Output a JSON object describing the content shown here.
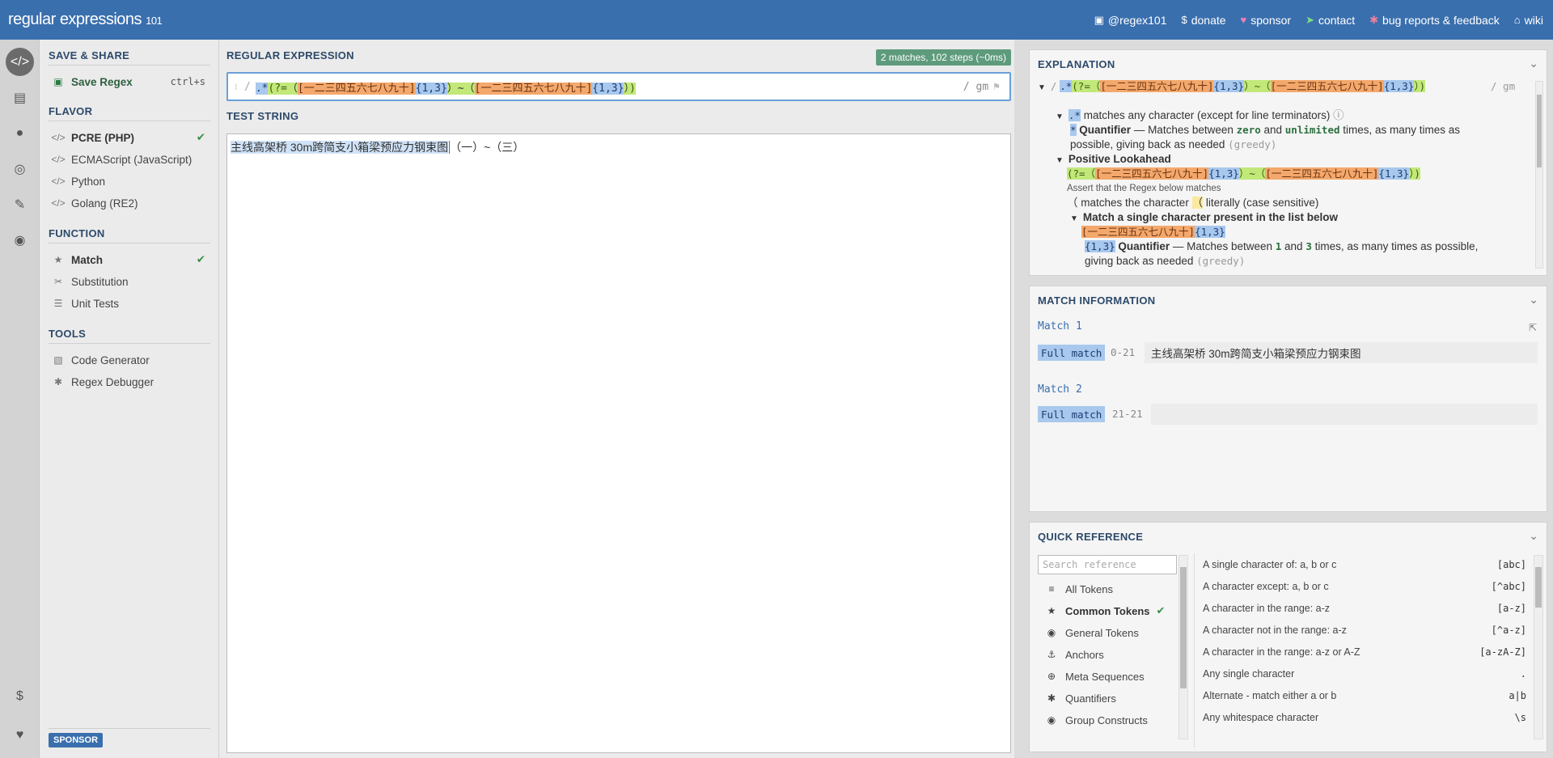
{
  "header": {
    "logo_main": "regular expressions",
    "logo_sup": "101",
    "nav": [
      {
        "icon": "twitter-icon",
        "label": "@regex101"
      },
      {
        "icon": "dollar-icon",
        "label": "donate"
      },
      {
        "icon": "heart-icon",
        "label": "sponsor"
      },
      {
        "icon": "paper-plane-icon",
        "label": "contact"
      },
      {
        "icon": "bug-icon",
        "label": "bug reports & feedback"
      },
      {
        "icon": "bank-icon",
        "label": "wiki"
      }
    ]
  },
  "sidebar": {
    "save_share_title": "SAVE & SHARE",
    "save_label": "Save Regex",
    "save_shortcut": "ctrl+s",
    "flavor_title": "FLAVOR",
    "flavors": [
      "PCRE (PHP)",
      "ECMAScript (JavaScript)",
      "Python",
      "Golang (RE2)"
    ],
    "function_title": "FUNCTION",
    "functions": [
      "Match",
      "Substitution",
      "Unit Tests"
    ],
    "tools_title": "TOOLS",
    "tools": [
      "Code Generator",
      "Regex Debugger"
    ],
    "sponsor_label": "SPONSOR"
  },
  "main": {
    "regex_title": "REGULAR EXPRESSION",
    "match_badge": "2 matches, 102 steps (~0ms)",
    "delim_open": "/",
    "regex_parts": {
      "any": ".*",
      "look_open": "(?=",
      "lit_lp1": "（",
      "set1": "[一二三四五六七八九十]",
      "q1": "{1,3}",
      "lit_rp1": "）",
      "tilde": "~",
      "lit_lp2": "（",
      "set2": "[一二三四五六七八九十]",
      "q2": "{1,3}",
      "lit_rp2": "）",
      "look_close": ")"
    },
    "flags": "/ gm",
    "test_title": "TEST STRING",
    "test_match": "主线高架桥 30m跨简支小箱梁预应力钢束图",
    "test_rest": "（一）~（三）"
  },
  "explanation": {
    "title": "EXPLANATION",
    "line_slash": "/",
    "line_flags": "/ gm",
    "any_desc": " matches any character (except for line terminators)",
    "quant_title": "Quantifier",
    "quant_desc_1": " — Matches between ",
    "zero": "zero",
    "and": " and ",
    "unlimited": "unlimited",
    "quant_desc_2": " times, as many times as",
    "quant_desc_3": "possible, giving back as needed ",
    "greedy": "(greedy)",
    "lookahead_title": "Positive Lookahead",
    "assert_text": "Assert that the Regex below matches",
    "lit_desc_1": " matches the character ",
    "lit_char": "（",
    "lit_desc_2": " literally (case sensitive)",
    "set_title": "Match a single character present in the list below",
    "quant2_title": "Quantifier",
    "quant2_desc_1": " — Matches between ",
    "one": "1",
    "three": "3",
    "quant2_desc_2": " times, as many times as possible,",
    "quant2_desc_3": "giving back as needed "
  },
  "match_info": {
    "title": "MATCH INFORMATION",
    "matches": [
      {
        "title": "Match 1",
        "badge": "Full match",
        "range": "0-21",
        "value": "主线高架桥 30m跨简支小箱梁预应力钢束图"
      },
      {
        "title": "Match 2",
        "badge": "Full match",
        "range": "21-21",
        "value": ""
      }
    ]
  },
  "quick_ref": {
    "title": "QUICK REFERENCE",
    "search_placeholder": "Search reference",
    "categories": [
      {
        "icon": "database-icon",
        "label": "All Tokens"
      },
      {
        "icon": "star-icon",
        "label": "Common Tokens"
      },
      {
        "icon": "target-icon",
        "label": "General Tokens"
      },
      {
        "icon": "anchor-icon",
        "label": "Anchors"
      },
      {
        "icon": "life-ring-icon",
        "label": "Meta Sequences"
      },
      {
        "icon": "asterisk-icon",
        "label": "Quantifiers"
      },
      {
        "icon": "target-icon",
        "label": "Group Constructs"
      }
    ],
    "items": [
      {
        "label": "A single character of: a, b or c",
        "code": "[abc]"
      },
      {
        "label": "A character except: a, b or c",
        "code": "[^abc]"
      },
      {
        "label": "A character in the range: a-z",
        "code": "[a-z]"
      },
      {
        "label": "A character not in the range: a-z",
        "code": "[^a-z]"
      },
      {
        "label": "A character in the range: a-z or A-Z",
        "code": "[a-zA-Z]"
      },
      {
        "label": "Any single character",
        "code": "."
      },
      {
        "label": "Alternate - match either a or b",
        "code": "a|b"
      },
      {
        "label": "Any whitespace character",
        "code": "\\s"
      }
    ]
  }
}
